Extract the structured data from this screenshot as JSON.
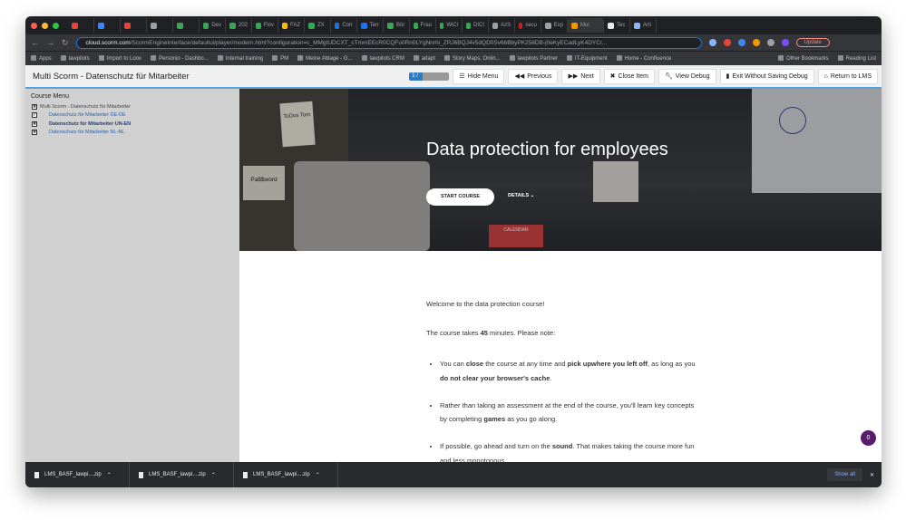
{
  "browser": {
    "tabs": [
      "",
      "",
      "",
      "",
      "",
      "Dev",
      "202",
      "Flov",
      "FAZ",
      "ZX",
      "Corr",
      "Terr",
      "Bör",
      "Frau",
      "WiCl",
      "DICI",
      "AzS",
      "secu",
      "Exp",
      "Mul",
      "Tec",
      "Arti"
    ],
    "active_tab_index": 19,
    "url_host": "cloud.scorm.com",
    "url_path": "/ScormEngineInterface/defaultui/player/modern.html?configuration=c_MMgtUDCXT_cTmmEEcR0CQFu0Rn0LYgNnrhi_ZRJ6BQJ4v5dQD0Sv6bBbyPK258DB-j0eKyECadLyK4DYCr...",
    "update_label": "Update",
    "bookmarks": [
      "Apps",
      "lawpilots",
      "Import to Loox",
      "Personio - Dashbo...",
      "Internal training",
      "PM",
      "Meine Ablage - G...",
      "lawpilots CRM",
      "adapt",
      "Story Maps, Onlin...",
      "lawpilots Partner",
      "IT-Equipment",
      "Home - Confluence"
    ],
    "other_bookmarks": "Other Bookmarks",
    "reading_list": "Reading List"
  },
  "header": {
    "title": "Multi Scorm - Datenschutz für Mitarbeiter",
    "progress_label": "1 / 3",
    "progress_fraction": 0.333,
    "buttons": {
      "hide_menu": "Hide Menu",
      "previous": "Previous",
      "next": "Next",
      "close_item": "Close Item",
      "view_debug": "View Debug",
      "exit": "Exit Without Saving Debug",
      "return": "Return to LMS"
    }
  },
  "menu": {
    "title": "Course Menu",
    "items": [
      {
        "label": "Multi Scorm - Datenschutz für Mitarbeiter",
        "mark": "✖"
      },
      {
        "label": "Datenschutz für Mitarbeiter DE-DE",
        "mark": "✔"
      },
      {
        "label": "Datenschutz für Mitarbeiter UN-EN",
        "mark": "✖"
      },
      {
        "label": "Datenschutz für Mitarbeiter NL-NL",
        "mark": "✖"
      }
    ]
  },
  "course": {
    "hero_title": "Data protection for employees",
    "start": "START COURSE",
    "details": "DETAILS",
    "scene_text": {
      "todo": "ToDos Tom",
      "password": "Pa$$word",
      "calendar": "CALENDAR"
    },
    "welcome": "Welcome to the data protection course!",
    "duration_pre": "The course takes ",
    "duration": "45",
    "duration_post": " minutes. Please note:",
    "bullets": [
      [
        "You can ",
        {
          "b": "close"
        },
        " the course at any time and ",
        {
          "b": "pick upwhere you left off"
        },
        ", as long as you ",
        {
          "b": "do not clear your browser's cache"
        },
        "."
      ],
      [
        "Rather than taking an assessment at the end of the course, you'll learn key concepts by completing ",
        {
          "b": "games"
        },
        " as you go along."
      ],
      [
        "If possible, go ahead and turn on the ",
        {
          "b": "sound"
        },
        ". That makes taking the course more fun and less monotonous."
      ]
    ],
    "badge": "0"
  },
  "downloads": {
    "items": [
      "LMS_BASF_lawpi....zip",
      "LMS_BASF_lawpi....zip",
      "LMS_BASF_lawpi....zip"
    ],
    "show_all": "Show all",
    "close": "✕"
  }
}
